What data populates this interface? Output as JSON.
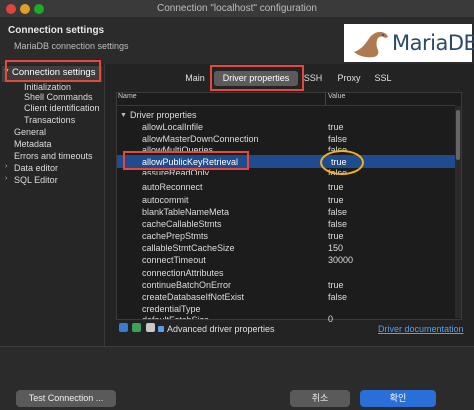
{
  "window": {
    "title": "Connection \"localhost\" configuration"
  },
  "header": {
    "title": "Connection settings",
    "subtitle": "MariaDB connection settings",
    "logo_text": "MariaDB"
  },
  "sidebar": {
    "items": [
      {
        "label": "Connection settings"
      },
      {
        "label": "Initialization"
      },
      {
        "label": "Shell Commands"
      },
      {
        "label": "Client identification"
      },
      {
        "label": "Transactions"
      },
      {
        "label": "General"
      },
      {
        "label": "Metadata"
      },
      {
        "label": "Errors and timeouts"
      },
      {
        "label": "Data editor"
      },
      {
        "label": "SQL Editor"
      }
    ]
  },
  "tabs": [
    {
      "label": "Main"
    },
    {
      "label": "Driver properties"
    },
    {
      "label": "SSH"
    },
    {
      "label": "Proxy"
    },
    {
      "label": "SSL"
    }
  ],
  "table": {
    "headers": {
      "name": "Name",
      "value": "Value"
    },
    "group": "Driver properties",
    "rows": [
      {
        "name": "allowLocalInfile",
        "value": "true"
      },
      {
        "name": "allowMasterDownConnection",
        "value": "false"
      },
      {
        "name": "allowMultiQueries",
        "value": "false"
      },
      {
        "name": "allowPublicKeyRetrieval",
        "value": "true"
      },
      {
        "name": "assureReadOnly",
        "value": "false"
      },
      {
        "name": "autoReconnect",
        "value": "true"
      },
      {
        "name": "autocommit",
        "value": "true"
      },
      {
        "name": "blankTableNameMeta",
        "value": "false"
      },
      {
        "name": "cacheCallableStmts",
        "value": "false"
      },
      {
        "name": "cachePrepStmts",
        "value": "true"
      },
      {
        "name": "callableStmtCacheSize",
        "value": "150"
      },
      {
        "name": "connectTimeout",
        "value": "30000"
      },
      {
        "name": "connectionAttributes",
        "value": ""
      },
      {
        "name": "continueBatchOnError",
        "value": "true"
      },
      {
        "name": "createDatabaseIfNotExist",
        "value": "false"
      },
      {
        "name": "credentialType",
        "value": ""
      },
      {
        "name": "defaultFetchSize",
        "value": "0"
      }
    ]
  },
  "bottom": {
    "advanced_label": "Advanced driver properties",
    "doc_link": "Driver documentation"
  },
  "footer": {
    "test_button": "Test Connection ...",
    "cancel_button": "취소",
    "ok_button": "확인"
  },
  "colors": {
    "accent": "#2a6ed8",
    "highlight": "#e8483c",
    "circle": "#f2b01e",
    "selection": "#1f4c8f"
  }
}
